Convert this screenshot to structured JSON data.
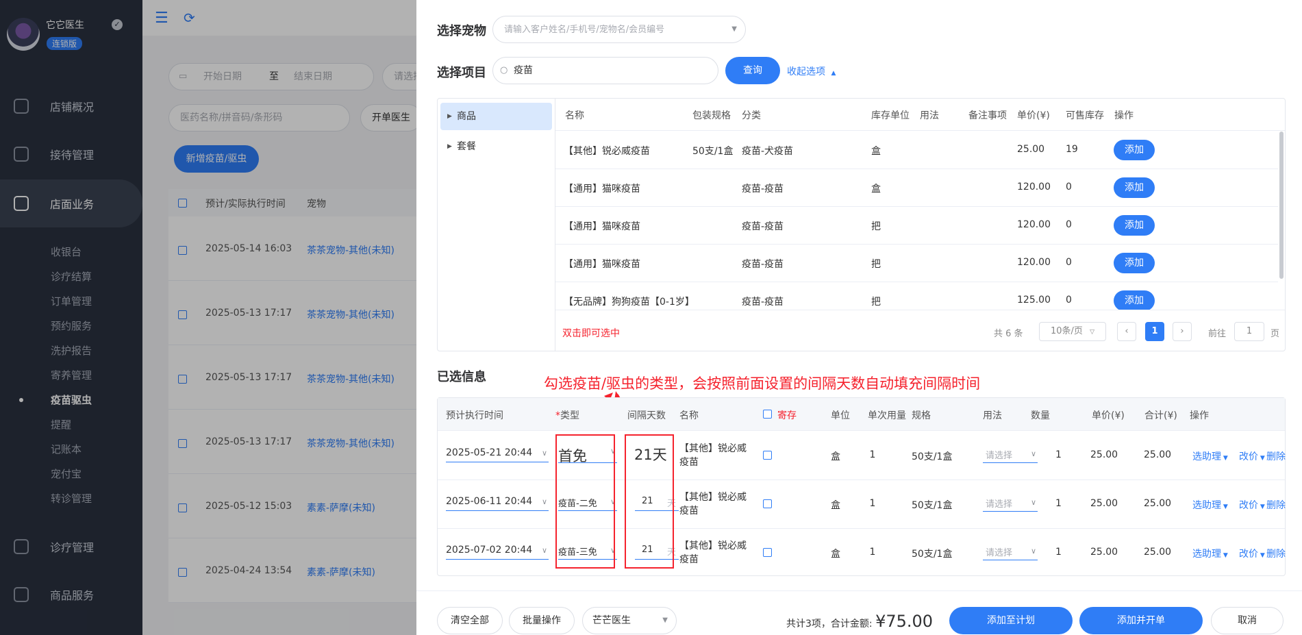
{
  "sidebar": {
    "brand_name": "它它医生",
    "brand_badge": "连锁版",
    "nav": [
      {
        "label": "店铺概况",
        "icon": "dashboard-icon"
      },
      {
        "label": "接待管理",
        "icon": "reception-icon"
      },
      {
        "label": "店面业务",
        "icon": "store-icon"
      },
      {
        "label": "诊疗管理",
        "icon": "medical-icon"
      },
      {
        "label": "商品服务",
        "icon": "goods-icon"
      }
    ],
    "sub": [
      "收银台",
      "诊疗结算",
      "订单管理",
      "预约服务",
      "洗护报告",
      "寄养管理",
      "疫苗驱虫",
      "提醒",
      "记账本",
      "宠付宝",
      "转诊管理"
    ],
    "sub_active_index": 6
  },
  "bg": {
    "start_date": "开始日期",
    "to": "至",
    "end_date": "结束日期",
    "select_placeholder": "请选择",
    "drug_placeholder": "医药名称/拼音码/条形码",
    "doctor_label": "开单医生",
    "new_button": "新增疫苗/驱虫",
    "col_time": "预计/实际执行时间",
    "col_pet": "宠物",
    "rows": [
      {
        "time": "2025-05-14 16:03",
        "pet": "茶茶宠物-其他(未知)"
      },
      {
        "time": "2025-05-13 17:17",
        "pet": "茶茶宠物-其他(未知)"
      },
      {
        "time": "2025-05-13 17:17",
        "pet": "茶茶宠物-其他(未知)"
      },
      {
        "time": "2025-05-13 17:17",
        "pet": "茶茶宠物-其他(未知)"
      },
      {
        "time": "2025-05-12 15:03",
        "pet": "素素-萨摩(未知)"
      },
      {
        "time": "2025-04-24 13:54",
        "pet": "素素-萨摩(未知)"
      }
    ]
  },
  "drawer": {
    "select_pet_label": "选择宠物",
    "select_pet_placeholder": "请输入客户姓名/手机号/宠物名/会员编号",
    "select_item_label": "选择项目",
    "search_value": "疫苗",
    "query_button": "查询",
    "collapse_link": "收起选项",
    "tree": [
      "商品",
      "套餐"
    ],
    "product_columns": [
      "名称",
      "包装规格",
      "分类",
      "库存单位",
      "用法",
      "备注事项",
      "单价(¥)",
      "可售库存",
      "操作"
    ],
    "products": [
      {
        "name": "【其他】锐必威疫苗",
        "spec": "50支/1盒",
        "category": "疫苗-犬疫苗",
        "unit": "盒",
        "price": "25.00",
        "stock": "19",
        "action": "添加"
      },
      {
        "name": "【通用】猫咪疫苗",
        "spec": "",
        "category": "疫苗-疫苗",
        "unit": "盒",
        "price": "120.00",
        "stock": "0",
        "action": "添加"
      },
      {
        "name": "【通用】猫咪疫苗",
        "spec": "",
        "category": "疫苗-疫苗",
        "unit": "把",
        "price": "120.00",
        "stock": "0",
        "action": "添加"
      },
      {
        "name": "【通用】猫咪疫苗",
        "spec": "",
        "category": "疫苗-疫苗",
        "unit": "把",
        "price": "120.00",
        "stock": "0",
        "action": "添加"
      },
      {
        "name": "【无品牌】狗狗疫苗【0-1岁】",
        "spec": "",
        "category": "疫苗-疫苗",
        "unit": "把",
        "price": "125.00",
        "stock": "0",
        "action": "添加"
      }
    ],
    "hint": "双击即可选中",
    "pager": {
      "total": "共 6 条",
      "per_page": "10条/页",
      "current": "1",
      "goto": "前往",
      "goto_value": "1",
      "page_unit": "页"
    },
    "selected_label": "已选信息",
    "annotation": "勾选疫苗/驱虫的类型，会按照前面设置的间隔天数自动填充间隔时间",
    "selected_columns": {
      "time": "预计执行时间",
      "required": "*",
      "type": "类型",
      "interval": "间隔天数",
      "name": "名称",
      "boarding": "寄存",
      "unit": "单位",
      "dose": "单次用量",
      "spec": "规格",
      "usage": "用法",
      "qty": "数量",
      "price": "单价(¥)",
      "total": "合计(¥)",
      "ops": "操作"
    },
    "selected_rows": [
      {
        "time": "2025-05-21 20:44",
        "type": "首免",
        "interval": "21天",
        "name": "【其他】锐必威疫苗",
        "unit": "盒",
        "dose": "1",
        "spec": "50支/1盒",
        "usage": "请选择",
        "qty": "1",
        "price": "25.00",
        "total": "25.00"
      },
      {
        "time": "2025-06-11 20:44",
        "type": "疫苗-二免",
        "interval": "21",
        "interval_unit": "天",
        "name": "【其他】锐必威疫苗",
        "unit": "盒",
        "dose": "1",
        "spec": "50支/1盒",
        "usage": "请选择",
        "qty": "1",
        "price": "25.00",
        "total": "25.00"
      },
      {
        "time": "2025-07-02 20:44",
        "type": "疫苗-三免",
        "interval": "21",
        "interval_unit": "天",
        "name": "【其他】锐必威疫苗",
        "unit": "盒",
        "dose": "1",
        "spec": "50支/1盒",
        "usage": "请选择",
        "qty": "1",
        "price": "25.00",
        "total": "25.00"
      }
    ],
    "row_ops": {
      "assistant": "选助理",
      "reprice": "改价",
      "delete": "删除"
    },
    "footer": {
      "clear": "清空全部",
      "batch": "批量操作",
      "doctor": "芒芒医生",
      "summary": "共计3项，合计金额: ",
      "amount": "¥75.00",
      "add_plan": "添加至计划",
      "add_order": "添加并开单",
      "cancel": "取消"
    }
  },
  "colors": {
    "primary": "#2f7df6",
    "sidebar": "#2a3140",
    "danger": "#f5222d"
  }
}
